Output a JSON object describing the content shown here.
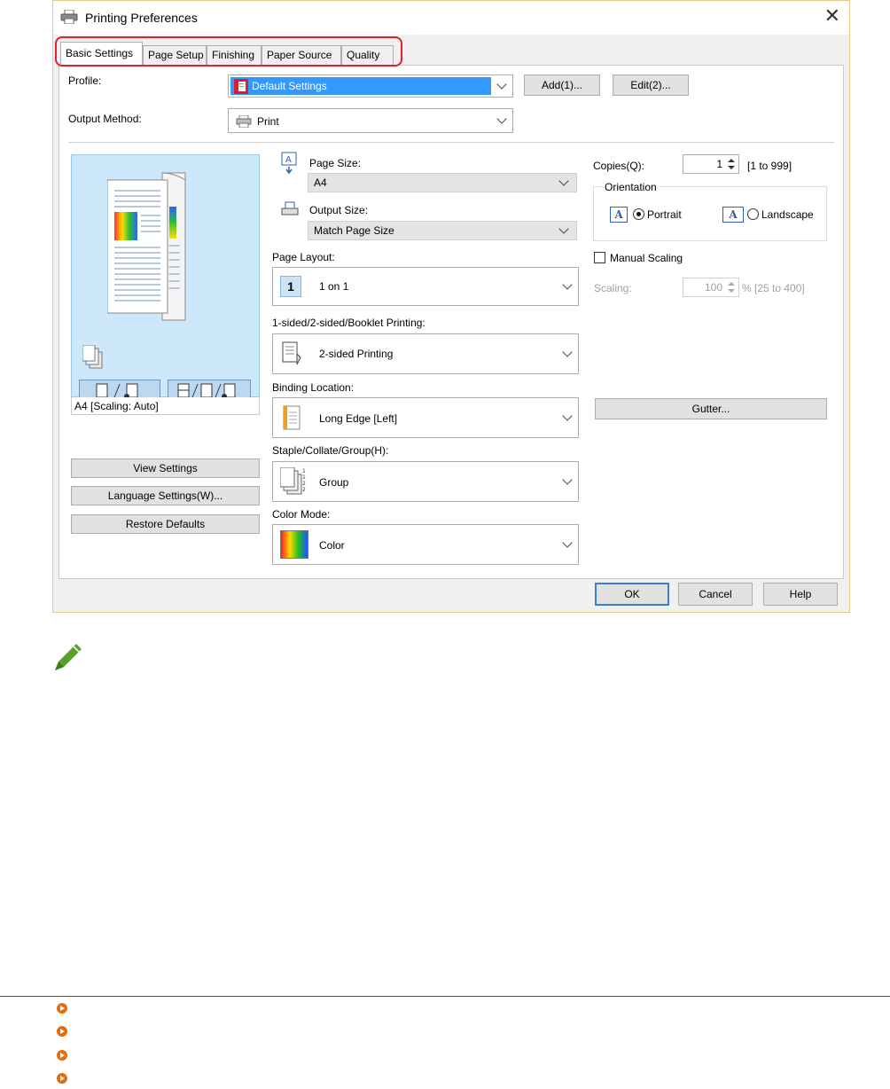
{
  "dialog": {
    "title": "Printing Preferences",
    "close_glyph": "✕",
    "tabs": [
      "Basic Settings",
      "Page Setup",
      "Finishing",
      "Paper Source",
      "Quality"
    ],
    "active_tab": "Basic Settings",
    "highlight_color": "#e0202c"
  },
  "profile": {
    "label": "Profile:",
    "value": "Default Settings",
    "add_label": "Add(1)...",
    "edit_label": "Edit(2)..."
  },
  "output_method": {
    "label": "Output Method:",
    "value": "Print"
  },
  "preview": {
    "caption": "A4 [Scaling: Auto]",
    "view_settings": "View Settings",
    "language_settings": "Language Settings(W)...",
    "restore_defaults": "Restore Defaults"
  },
  "page_size": {
    "label": "Page Size:",
    "value": "A4"
  },
  "output_size": {
    "label": "Output Size:",
    "value": "Match Page Size"
  },
  "page_layout": {
    "label": "Page Layout:",
    "value": "1 on 1",
    "icon_text": "1"
  },
  "sided_printing": {
    "label": "1-sided/2-sided/Booklet Printing:",
    "value": "2-sided Printing"
  },
  "binding_location": {
    "label": "Binding Location:",
    "value": "Long Edge [Left]"
  },
  "staple": {
    "label": "Staple/Collate/Group(H):",
    "value": "Group"
  },
  "color_mode": {
    "label": "Color Mode:",
    "value": "Color"
  },
  "copies": {
    "label": "Copies(Q):",
    "value": "1",
    "range": "[1 to 999]"
  },
  "orientation": {
    "label": "Orientation",
    "portrait": "Portrait",
    "landscape": "Landscape",
    "icon_letter": "A",
    "selected": "Portrait"
  },
  "manual_scaling": {
    "label": "Manual Scaling",
    "checked": false
  },
  "scaling": {
    "label": "Scaling:",
    "value": "100",
    "range": "% [25 to 400]"
  },
  "gutter_label": "Gutter...",
  "footer_buttons": {
    "ok": "OK",
    "cancel": "Cancel",
    "help": "Help"
  },
  "colors": {
    "accent_orange": "#e46c0a",
    "note_green": "#5aa02c",
    "selection_blue": "#3399ff"
  }
}
